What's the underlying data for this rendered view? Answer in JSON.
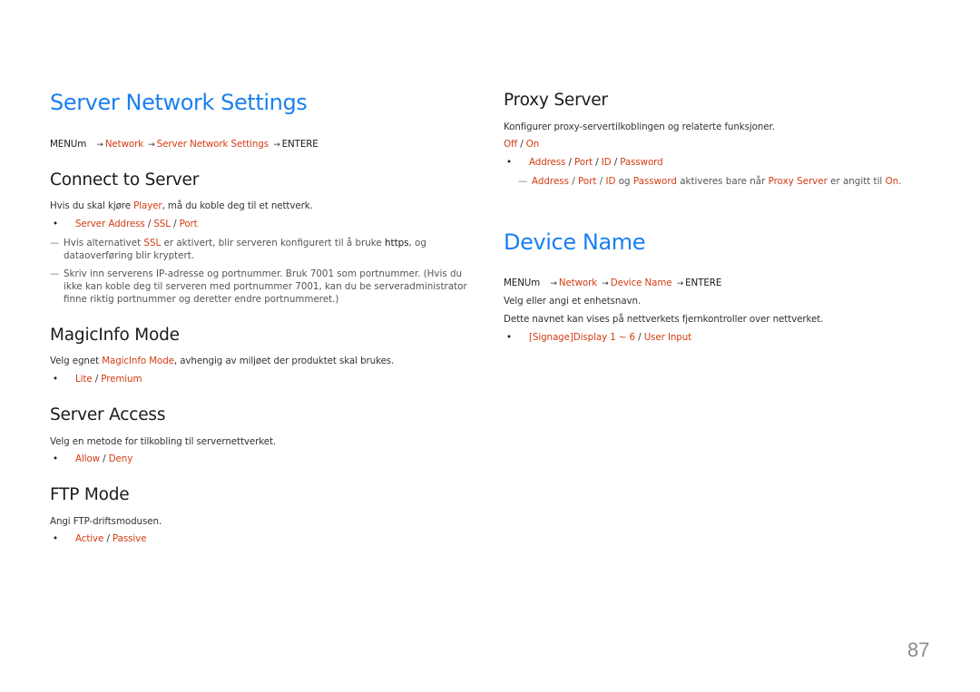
{
  "left": {
    "title": "Server Network Settings",
    "breadcrumb": {
      "menu": "MENUm",
      "arrow": "→",
      "items": [
        "Network",
        "Server Network Settings"
      ],
      "enter": "ENTERE"
    },
    "sections": {
      "connect": {
        "heading": "Connect to Server",
        "desc_pre": "Hvis du skal kjøre ",
        "desc_link": "Player",
        "desc_post": ", må du koble deg til et nettverk.",
        "options": [
          "Server Address",
          "SSL",
          "Port"
        ],
        "note1_pre": "Hvis alternativet ",
        "note1_link": "SSL",
        "note1_mid": " er aktivert, blir serveren konfigurert til å bruke ",
        "note1_bold": "https",
        "note1_post": ", og dataoverføring blir kryptert.",
        "note2": "Skriv inn serverens IP-adresse og portnummer. Bruk 7001 som portnummer. (Hvis du ikke kan koble deg til serveren med portnummer 7001, kan du be serveradministrator finne riktig portnummer og deretter endre portnummeret.)"
      },
      "magicinfo": {
        "heading": "MagicInfo Mode",
        "desc_pre": "Velg egnet ",
        "desc_link": "MagicInfo Mode",
        "desc_post": ", avhengig av miljøet der produktet skal brukes.",
        "options": [
          "Lite",
          "Premium"
        ]
      },
      "access": {
        "heading": "Server Access",
        "desc": "Velg en metode for tilkobling til servernettverket.",
        "options": [
          "Allow",
          "Deny"
        ]
      },
      "ftp": {
        "heading": "FTP Mode",
        "desc": "Angi FTP-driftsmodusen.",
        "options": [
          "Active",
          "Passive"
        ]
      }
    }
  },
  "right": {
    "proxy": {
      "heading": "Proxy Server",
      "desc": "Konfigurer proxy-servertilkoblingen og relaterte funksjoner.",
      "toggle": [
        "Off",
        "On"
      ],
      "options": [
        "Address",
        "Port",
        "ID",
        "Password"
      ],
      "note": {
        "items": [
          "Address",
          "Port",
          "ID"
        ],
        "og": " og ",
        "password": "Password",
        "mid": " aktiveres bare når ",
        "proxy": "Proxy Server",
        "post": " er angitt til ",
        "on": "On",
        "end": "."
      }
    },
    "device": {
      "title": "Device Name",
      "breadcrumb": {
        "menu": "MENUm",
        "arrow": "→",
        "items": [
          "Network",
          "Device Name"
        ],
        "enter": "ENTERE"
      },
      "desc1": "Velg eller angi et enhetsnavn.",
      "desc2": "Dette navnet kan vises på nettverkets fjernkontroller over nettverket.",
      "options": [
        "[Signage]Display 1 ~ 6",
        "User Input"
      ]
    }
  },
  "page_number": "87",
  "colors": {
    "title_blue": "#1b7ff0",
    "link_red": "#d23d14"
  }
}
